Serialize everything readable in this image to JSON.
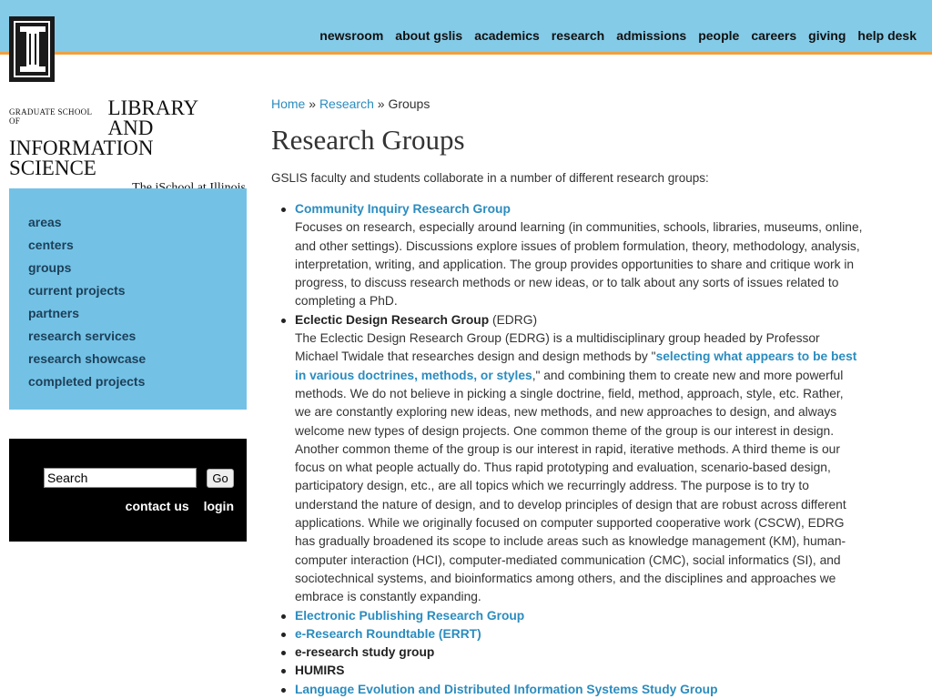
{
  "topnav": [
    "newsroom",
    "about gslis",
    "academics",
    "research",
    "admissions",
    "people",
    "careers",
    "giving",
    "help desk"
  ],
  "wordmark": {
    "prefix": "Graduate School of",
    "name_line1": "LIBRARY AND",
    "name_line2": "INFORMATION SCIENCE",
    "tagline": "The iSchool at Illinois"
  },
  "sidenav": [
    "areas",
    "centers",
    "groups",
    "current projects",
    "partners",
    "research services",
    "research showcase",
    "completed projects"
  ],
  "search": {
    "value": "Search",
    "go_label": "Go",
    "contact_label": "contact us",
    "login_label": "login"
  },
  "breadcrumb": {
    "home": "Home",
    "sep1": " » ",
    "research": "Research",
    "sep2": " » ",
    "current": "Groups"
  },
  "page_title": "Research Groups",
  "intro": "GSLIS faculty and students collaborate in a number of different research groups:",
  "groups": {
    "community": {
      "name": "Community Inquiry Research Group",
      "desc": "Focuses on research, especially around learning (in communities, schools, libraries, museums, online, and other settings). Discussions explore issues of problem formulation, theory, methodology, analysis, interpretation, writing, and application. The group provides opportunities to share and critique work in progress, to discuss research methods or new ideas, or to talk about any sorts of issues related to completing a PhD."
    },
    "edrg": {
      "name": "Eclectic Design Research Group",
      "abbr": " (EDRG)",
      "desc_before": "The Eclectic Design Research Group (EDRG) is a multidisciplinary group headed by Professor Michael Twidale that researches design and design methods by \"",
      "quote_link": "selecting what appears to be best in various doctrines, methods, or styles",
      "desc_after": ",\" and combining them to create new and more powerful methods. We do not believe in picking a single doctrine, field, method, approach, style, etc. Rather, we are constantly exploring new ideas, new methods, and new approaches to design, and always welcome new types of design projects. One common theme of the group is our interest in design. Another common theme of the group is our interest in rapid, iterative methods. A third theme is our focus on what people actually do. Thus rapid prototyping and evaluation, scenario-based design, participatory design, etc., are all topics which we recurringly address. The purpose is to try to understand the nature of design, and to develop principles of design that are robust across different applications. While we originally focused on computer supported cooperative work (CSCW), EDRG has gradually broadened its scope to include areas such as knowledge management (KM), human-computer interaction (HCI), computer-mediated communication (CMC), social informatics (SI), and sociotechnical systems, and bioinformatics among others, and the disciplines and approaches we embrace is constantly expanding."
    },
    "epub": {
      "name": "Electronic Publishing Research Group"
    },
    "errt": {
      "name": "e-Research Roundtable (ERRT)"
    },
    "eresearch": {
      "name": "e-research study group"
    },
    "humirs": {
      "name": "HUMIRS"
    },
    "ledis": {
      "name": "Language Evolution and Distributed Information Systems Study Group"
    }
  }
}
